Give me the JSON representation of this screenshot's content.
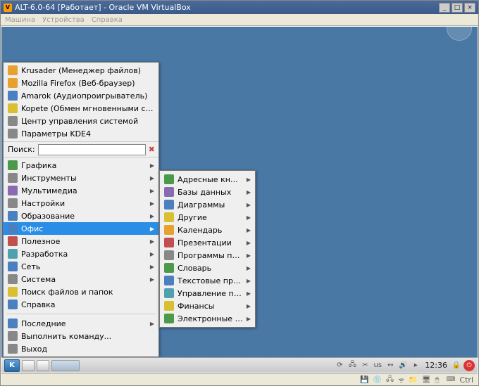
{
  "vbox": {
    "title": "ALT-6.0-64 [Работает] - Oracle VM VirtualBox",
    "menu": [
      "Машина",
      "Устройства",
      "Справка"
    ],
    "win_min": "_",
    "win_max": "□",
    "win_close": "×",
    "status_key": "Ctrl"
  },
  "search": {
    "label": "Поиск:",
    "value": ""
  },
  "favorites": [
    {
      "icon": "c-or",
      "label": "Krusader (Менеджер файлов)"
    },
    {
      "icon": "c-or",
      "label": "Mozilla Firefox (Веб-браузер)"
    },
    {
      "icon": "c-bl",
      "label": "Amarok (Аудиопроигрыватель)"
    },
    {
      "icon": "c-yl",
      "label": "Kopete (Обмен мгновенными сообщениями)"
    },
    {
      "icon": "c-gy",
      "label": "Центр управления системой"
    },
    {
      "icon": "c-gy",
      "label": "Параметры KDE4"
    }
  ],
  "categories": [
    {
      "icon": "c-gn",
      "label": "Графика"
    },
    {
      "icon": "c-gy",
      "label": "Инструменты"
    },
    {
      "icon": "c-pu",
      "label": "Мультимедиа"
    },
    {
      "icon": "c-gy",
      "label": "Настройки"
    },
    {
      "icon": "c-bl",
      "label": "Образование"
    },
    {
      "icon": "c-bl",
      "label": "Офис",
      "selected": true
    },
    {
      "icon": "c-rd",
      "label": "Полезное"
    },
    {
      "icon": "c-cy",
      "label": "Разработка"
    },
    {
      "icon": "c-bl",
      "label": "Сеть"
    },
    {
      "icon": "c-gy",
      "label": "Система"
    },
    {
      "icon": "c-yl",
      "label": "Поиск файлов и папок",
      "noarrow": true
    },
    {
      "icon": "c-bl",
      "label": "Справка",
      "noarrow": true
    }
  ],
  "bottom": [
    {
      "icon": "c-bl",
      "label": "Последние",
      "arrow": true
    },
    {
      "icon": "c-gy",
      "label": "Выполнить команду..."
    },
    {
      "icon": "c-gy",
      "label": "Выход"
    }
  ],
  "submenu": [
    {
      "icon": "c-gn",
      "label": "Адресные книги"
    },
    {
      "icon": "c-pu",
      "label": "Базы данных"
    },
    {
      "icon": "c-bl",
      "label": "Диаграммы"
    },
    {
      "icon": "c-yl",
      "label": "Другие"
    },
    {
      "icon": "c-or",
      "label": "Календарь"
    },
    {
      "icon": "c-rd",
      "label": "Презентации"
    },
    {
      "icon": "c-gy",
      "label": "Программы просмотра"
    },
    {
      "icon": "c-gn",
      "label": "Словарь"
    },
    {
      "icon": "c-bl",
      "label": "Текстовые процессоры"
    },
    {
      "icon": "c-cy",
      "label": "Управление проектами"
    },
    {
      "icon": "c-yl",
      "label": "Финансы"
    },
    {
      "icon": "c-gn",
      "label": "Электронные таблицы"
    }
  ],
  "taskbar": {
    "kde_label": "K",
    "lang": "us",
    "clock": "12:36"
  }
}
